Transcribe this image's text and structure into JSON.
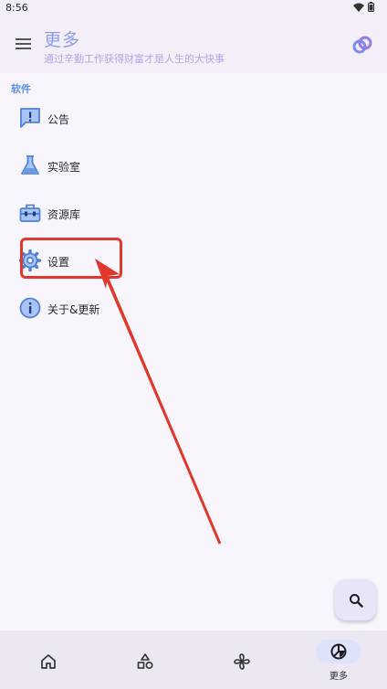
{
  "status": {
    "time": "8:56"
  },
  "app_bar": {
    "title": "更多",
    "subtitle": "通过辛勤工作获得财富才是人生的大快事"
  },
  "section": {
    "title": "软件"
  },
  "items": [
    {
      "label": "公告",
      "icon": "announcement-icon"
    },
    {
      "label": "实验室",
      "icon": "flask-icon"
    },
    {
      "label": "资源库",
      "icon": "toolbox-icon"
    },
    {
      "label": "设置",
      "icon": "gear-icon"
    },
    {
      "label": "关于&更新",
      "icon": "info-icon"
    }
  ],
  "fab": {
    "icon": "search-icon"
  },
  "bottom_nav": [
    {
      "icon": "home-icon",
      "label": ""
    },
    {
      "icon": "shapes-icon",
      "label": ""
    },
    {
      "icon": "pinwheel-icon",
      "label": ""
    },
    {
      "icon": "more-icon",
      "label": "更多",
      "active": true
    }
  ],
  "colors": {
    "accent": "#5c8ff0",
    "title": "#8c9df0",
    "subtitle": "#b8a4ea",
    "annotation": "#e0382a",
    "background": "#f8f6fc"
  }
}
